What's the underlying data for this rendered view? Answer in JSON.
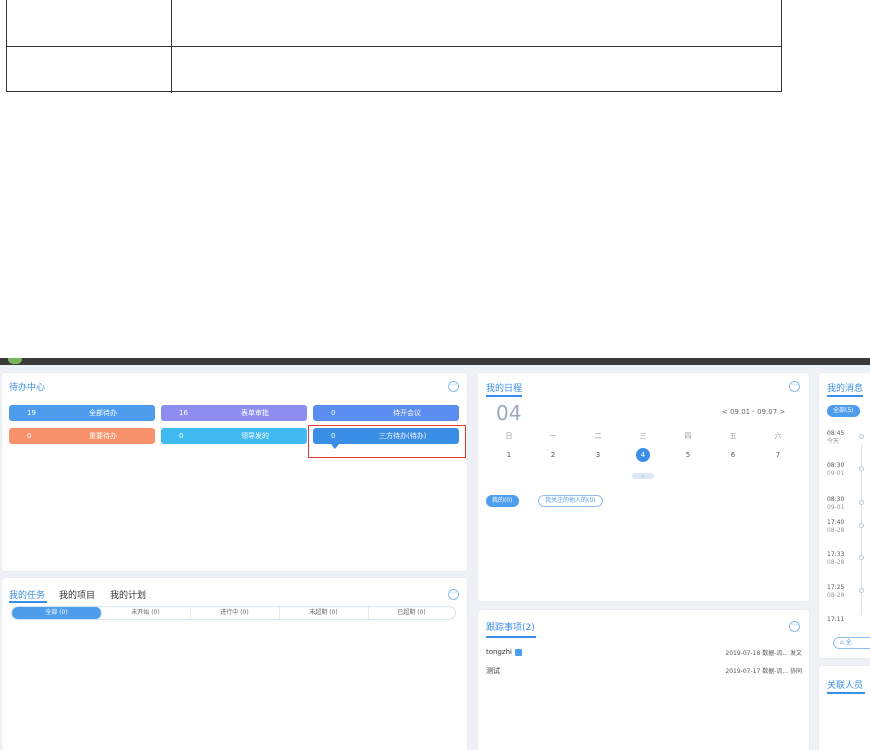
{
  "todo": {
    "title": "待办中心",
    "tiles": [
      {
        "count": "19",
        "label": "全部待办"
      },
      {
        "count": "16",
        "label": "表单审批"
      },
      {
        "count": "0",
        "label": "待开会议"
      },
      {
        "count": "0",
        "label": "重要待办"
      },
      {
        "count": "0",
        "label": "领导发的"
      },
      {
        "count": "0",
        "label": "三方待办(待办)"
      }
    ]
  },
  "tasks": {
    "tabs": [
      "我的任务",
      "我的项目",
      "我的计划"
    ],
    "filters": [
      "全部 (0)",
      "未开始 (0)",
      "进行中 (0)",
      "未超期 (0)",
      "已超期 (0)"
    ]
  },
  "schedule": {
    "title": "我的日程",
    "day": "04",
    "week_range": "<  09.01 - 09.07  >",
    "weekdays": [
      "日",
      "一",
      "二",
      "三",
      "四",
      "五",
      "六"
    ],
    "dates": [
      "1",
      "2",
      "3",
      "4",
      "5",
      "6",
      "7"
    ],
    "filters": [
      "我的(0)",
      "我关注的他人的(0)"
    ]
  },
  "tracking": {
    "title": "跟踪事项(2)",
    "items": [
      {
        "name": "tongzhi",
        "meta": "2019-07-18    数据-流...   发文"
      },
      {
        "name": "测试",
        "meta": "2019-07-17    数据-流...   协同"
      }
    ]
  },
  "messages": {
    "title": "我的消息",
    "filter": "全部(5)",
    "times": [
      {
        "time": "08:45",
        "date": "今天"
      },
      {
        "time": "08:30",
        "date": "09-01"
      },
      {
        "time": "08:30",
        "date": "09-01"
      },
      {
        "time": "17:40",
        "date": "08-28"
      },
      {
        "time": "17:33",
        "date": "08-28"
      },
      {
        "time": "17:25",
        "date": "08-28"
      },
      {
        "time": "17:11",
        "date": ""
      }
    ],
    "footer": "全"
  },
  "related": {
    "title": "关联人员"
  },
  "colors": {
    "accent": "#3a8ee6",
    "highlight": "#e53935"
  }
}
